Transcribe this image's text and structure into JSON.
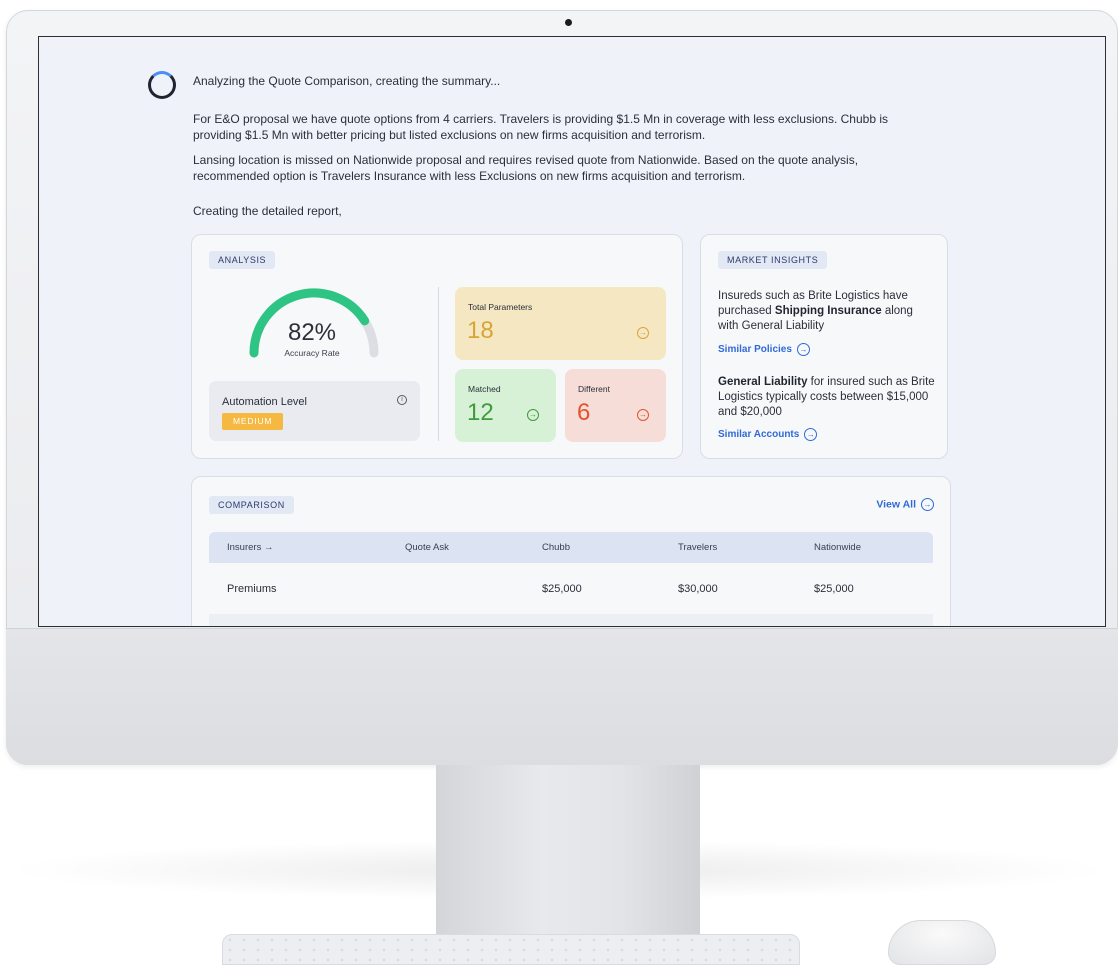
{
  "status": "Analyzing the Quote Comparison, creating the summary...",
  "summary": {
    "paragraph1": "For E&O proposal we have quote options from 4 carriers. Travelers is providing $1.5 Mn in coverage with less exclusions. Chubb is providing $1.5 Mn with better pricing but listed exclusions on new firms acquisition and terrorism.",
    "paragraph2": "Lansing location is missed on Nationwide proposal and requires revised quote from Nationwide. Based on the quote analysis, recommended option is Travelers Insurance with less Exclusions on new firms acquisition and terrorism.",
    "paragraph3": "Creating the detailed report,"
  },
  "analysis": {
    "tag": "ANALYSIS",
    "accuracy_value": "82%",
    "accuracy_fraction": 0.82,
    "accuracy_label": "Accuracy Rate",
    "automation_label": "Automation Level",
    "automation_badge": "MEDIUM",
    "total_label": "Total Parameters",
    "total_value": "18",
    "matched_label": "Matched",
    "matched_value": "12",
    "different_label": "Different",
    "different_value": "6"
  },
  "insights": {
    "tag": "MARKET INSIGHTS",
    "insight1_a": "Insureds such as Brite Logistics have purchased ",
    "insight1_b": "Shipping Insurance",
    "insight1_c": " along with General Liability",
    "link1": "Similar Policies",
    "insight2_a": "General Liability",
    "insight2_b": " for insured such as Brite Logistics typically costs between $15,000 and $20,000",
    "link2": "Similar Accounts"
  },
  "comparison": {
    "tag": "COMPARISON",
    "view_all": "View All",
    "headers": [
      "Insurers →",
      "Quote Ask",
      "Chubb",
      "Travelers",
      "Nationwide"
    ],
    "rows": [
      {
        "label": "Premiums",
        "quote_ask": "",
        "chubb": "$25,000",
        "travelers": "$30,000",
        "nationwide": "$25,000"
      }
    ]
  },
  "colors": {
    "gauge_fill": "#2ec483",
    "gauge_track": "#dcdee3",
    "link": "#2f6ad8"
  }
}
